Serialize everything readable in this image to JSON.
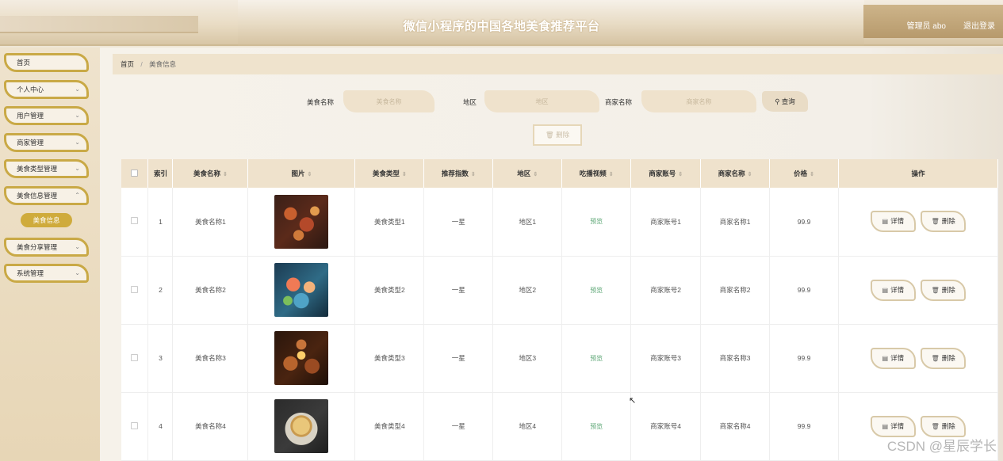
{
  "header": {
    "title": "微信小程序的中国各地美食推荐平台",
    "admin": "管理员 abo",
    "logout": "退出登录"
  },
  "sidebar": {
    "items": [
      {
        "label": "首页",
        "chevron": false
      },
      {
        "label": "个人中心",
        "chevron": true
      },
      {
        "label": "用户管理",
        "chevron": true
      },
      {
        "label": "商家管理",
        "chevron": true
      },
      {
        "label": "美食类型管理",
        "chevron": true
      },
      {
        "label": "美食信息管理",
        "chevron": true
      },
      {
        "label": "美食分享管理",
        "chevron": true
      },
      {
        "label": "系统管理",
        "chevron": true
      }
    ],
    "active_sub": "美食信息"
  },
  "breadcrumb": {
    "home": "首页",
    "separator": "/",
    "current": "美食信息"
  },
  "search": {
    "name_label": "美食名称",
    "name_placeholder": "美食名称",
    "region_label": "地区",
    "region_placeholder": "地区",
    "merchant_label": "商家名称",
    "merchant_placeholder": "商家名称",
    "button": "查询",
    "button_icon": "search-icon"
  },
  "toolbar": {
    "delete_label": "删除",
    "delete_icon": "trash-icon"
  },
  "table": {
    "headers": [
      "索引",
      "美食名称",
      "图片",
      "美食类型",
      "推荐指数",
      "地区",
      "吃播视频",
      "商家账号",
      "商家名称",
      "价格",
      "操作"
    ],
    "rows": [
      {
        "index": "1",
        "name": "美食名称1",
        "type": "美食类型1",
        "rating": "一星",
        "region": "地区1",
        "video": "预览",
        "account": "商家账号1",
        "merchant": "商家名称1",
        "price": "99.9",
        "image_theme": "dark-red-dish"
      },
      {
        "index": "2",
        "name": "美食名称2",
        "type": "美食类型2",
        "rating": "一星",
        "region": "地区2",
        "video": "预览",
        "account": "商家账号2",
        "merchant": "商家名称2",
        "price": "99.9",
        "image_theme": "sashimi-platter"
      },
      {
        "index": "3",
        "name": "美食名称3",
        "type": "美食类型3",
        "rating": "一星",
        "region": "地区3",
        "video": "预览",
        "account": "商家账号3",
        "merchant": "商家名称3",
        "price": "99.9",
        "image_theme": "candle-dishes"
      },
      {
        "index": "4",
        "name": "美食名称4",
        "type": "美食类型4",
        "rating": "一星",
        "region": "地区4",
        "video": "预览",
        "account": "商家账号4",
        "merchant": "商家名称4",
        "price": "99.9",
        "image_theme": "pastry-on-plate"
      }
    ],
    "detail_label": "详情",
    "detail_icon": "document-icon",
    "delete_label": "删除",
    "delete_icon": "trash-icon"
  },
  "watermark": "CSDN @星辰学长",
  "colors": {
    "accent_gold": "#c9a946",
    "beige": "#efe2cc",
    "preview_green": "#5aa573"
  }
}
